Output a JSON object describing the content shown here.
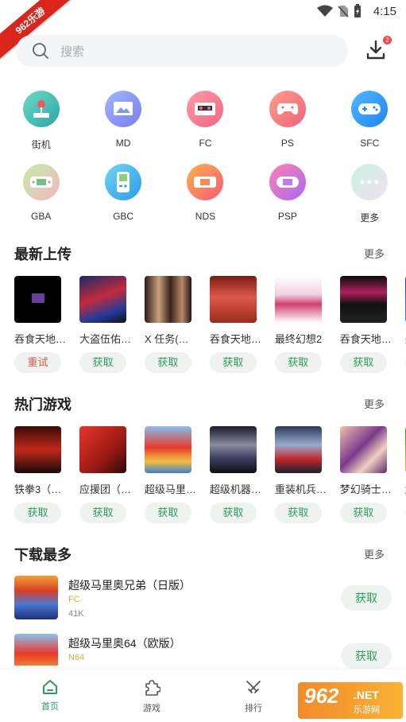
{
  "status": {
    "time": "4:15"
  },
  "ribbon": {
    "text": "962乐游"
  },
  "search": {
    "placeholder": "搜索"
  },
  "download": {
    "badge": "2"
  },
  "categories": [
    {
      "label": "街机",
      "icon": "arcade-joystick-icon"
    },
    {
      "label": "MD",
      "icon": "md-screen-icon"
    },
    {
      "label": "FC",
      "icon": "fc-cartridge-icon"
    },
    {
      "label": "PS",
      "icon": "ps-controller-icon"
    },
    {
      "label": "SFC",
      "icon": "sfc-controller-icon"
    },
    {
      "label": "GBA",
      "icon": "gba-handheld-icon"
    },
    {
      "label": "GBC",
      "icon": "gbc-handheld-icon"
    },
    {
      "label": "NDS",
      "icon": "nds-handheld-icon"
    },
    {
      "label": "PSP",
      "icon": "psp-handheld-icon"
    },
    {
      "label": "更多",
      "icon": "more-dots-icon"
    }
  ],
  "latest": {
    "title": "最新上传",
    "more": "更多",
    "items": [
      {
        "name": "吞食天地…",
        "button": "重试"
      },
      {
        "name": "大盗伍佑…",
        "button": "获取"
      },
      {
        "name": "X 任务(…",
        "button": "获取"
      },
      {
        "name": "吞食天地…",
        "button": "获取"
      },
      {
        "name": "最终幻想2",
        "button": "获取"
      },
      {
        "name": "吞食天地…",
        "button": "获取"
      },
      {
        "name": "美少",
        "button": "获"
      }
    ]
  },
  "hot": {
    "title": "热门游戏",
    "more": "更多",
    "items": [
      {
        "name": "铁拳3（…",
        "button": "获取"
      },
      {
        "name": "应援团（…",
        "button": "获取"
      },
      {
        "name": "超级马里…",
        "button": "获取"
      },
      {
        "name": "超级机器…",
        "button": "获取"
      },
      {
        "name": "重装机兵…",
        "button": "获取"
      },
      {
        "name": "梦幻骑士…",
        "button": "获取"
      },
      {
        "name": "解谜",
        "button": "获"
      }
    ]
  },
  "top": {
    "title": "下载最多",
    "more": "更多",
    "items": [
      {
        "name": "超级马里奥兄弟（日版）",
        "platform": "FC",
        "size": "41K",
        "button": "获取"
      },
      {
        "name": "超级马里奥64（欧版）",
        "platform": "N64",
        "size": "",
        "button": "获取"
      }
    ]
  },
  "tabs": [
    {
      "label": "首页",
      "icon": "home-icon",
      "active": true
    },
    {
      "label": "游戏",
      "icon": "puzzle-icon",
      "active": false
    },
    {
      "label": "排行",
      "icon": "swords-icon",
      "active": false
    }
  ],
  "watermark": {
    "logo": "962",
    "net": ".NET",
    "site": "乐游网"
  },
  "colors": {
    "accent": "#2a9d5c",
    "retry": "#e0564a",
    "platform": "#e0a93a"
  }
}
